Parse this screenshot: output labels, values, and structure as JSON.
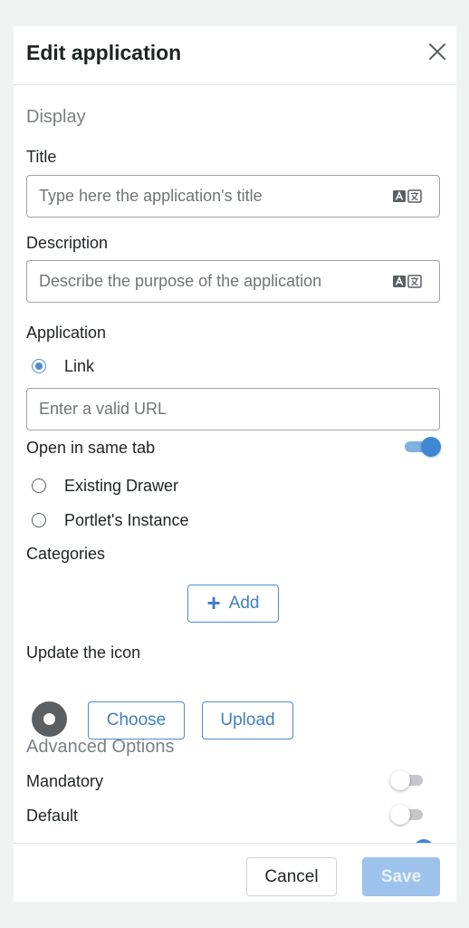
{
  "header": {
    "title": "Edit application"
  },
  "display": {
    "section_title": "Display",
    "title_label": "Title",
    "title_placeholder": "Type here the application's title",
    "description_label": "Description",
    "description_placeholder": "Describe the purpose of the application"
  },
  "application": {
    "label": "Application",
    "options": [
      {
        "label": "Link",
        "checked": true
      },
      {
        "label": "Existing Drawer",
        "checked": false
      },
      {
        "label": "Portlet's Instance",
        "checked": false
      }
    ],
    "url_placeholder": "Enter a valid URL",
    "open_same_tab_label": "Open in same tab",
    "open_same_tab_on": true
  },
  "categories": {
    "label": "Categories",
    "add_label": "Add"
  },
  "icon": {
    "label": "Update the icon",
    "choose_label": "Choose",
    "upload_label": "Upload"
  },
  "advanced": {
    "section_title": "Advanced Options",
    "mandatory_label": "Mandatory",
    "mandatory_on": false,
    "default_label": "Default",
    "default_on": false
  },
  "footer": {
    "cancel_label": "Cancel",
    "save_label": "Save"
  },
  "colors": {
    "accent": "#4a8bd4",
    "save_disabled": "#9dc2eb",
    "muted_text": "#7a7f85"
  }
}
